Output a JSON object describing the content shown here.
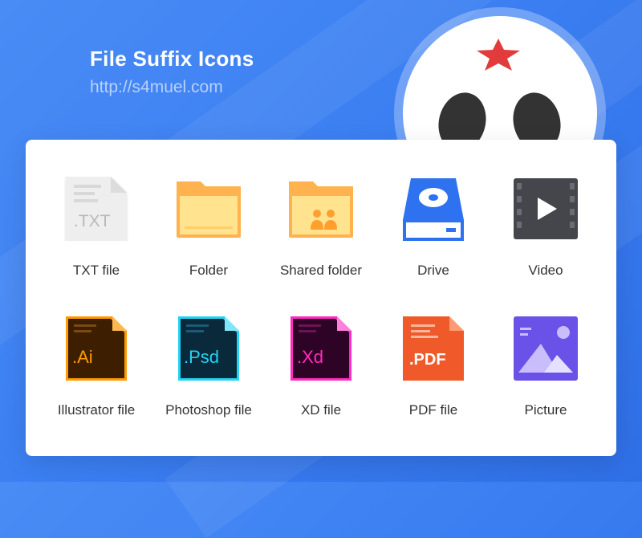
{
  "header": {
    "title": "File Suffix Icons",
    "url": "http://s4muel.com"
  },
  "colors": {
    "background": "#3b7ff2",
    "mascot_star": "#e23b3b",
    "mascot_eye": "#333333"
  },
  "icons": [
    {
      "label": "TXT file",
      "icon": "txt-file-icon",
      "badge": ".TXT"
    },
    {
      "label": "Folder",
      "icon": "folder-icon"
    },
    {
      "label": "Shared folder",
      "icon": "shared-folder-icon"
    },
    {
      "label": "Drive",
      "icon": "drive-icon"
    },
    {
      "label": "Video",
      "icon": "video-icon"
    },
    {
      "label": "Illustrator file",
      "icon": "illustrator-file-icon",
      "badge": ".Ai"
    },
    {
      "label": "Photoshop file",
      "icon": "photoshop-file-icon",
      "badge": ".Psd"
    },
    {
      "label": "XD file",
      "icon": "xd-file-icon",
      "badge": ".Xd"
    },
    {
      "label": "PDF file",
      "icon": "pdf-file-icon",
      "badge": ".PDF"
    },
    {
      "label": "Picture",
      "icon": "picture-icon"
    }
  ]
}
